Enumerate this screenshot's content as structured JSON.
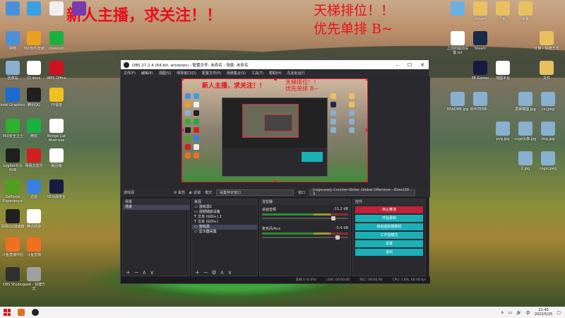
{
  "overlay": {
    "left": "新人主播，求关注！！",
    "right_line1": "天梯排位！！",
    "right_line2": "优先单排 B~"
  },
  "desktop_icons": [
    {
      "label": "",
      "icon": "computer-icon",
      "color": "#4a90d9"
    },
    {
      "label": "",
      "icon": "app-icon",
      "color": "#3aa0e0"
    },
    {
      "label": "",
      "icon": "document-icon",
      "color": "#eeeeee"
    },
    {
      "label": "",
      "icon": "app-icon",
      "color": "#7a3ab0"
    },
    {
      "label": "网络",
      "icon": "network-icon",
      "color": "#4a90d9"
    },
    {
      "label": "360软件管家",
      "icon": "app-icon",
      "color": "#e8a020"
    },
    {
      "label": "dyweixin",
      "icon": "app-icon",
      "color": "#1ab040"
    },
    {
      "label": "回收站",
      "icon": "recycle-bin-icon",
      "color": "#8ab0d0"
    },
    {
      "label": "打.docx",
      "icon": "document-icon",
      "color": "#ffffff"
    },
    {
      "label": "WPS Office",
      "icon": "wps-icon",
      "color": "#d01020"
    },
    {
      "label": "Intel Graphics",
      "icon": "app-icon",
      "color": "#1a6ad0"
    },
    {
      "label": "腾讯QQ",
      "icon": "qq-icon",
      "color": "#202020"
    },
    {
      "label": "YY语音",
      "icon": "app-icon",
      "color": "#f0c020"
    },
    {
      "label": "360安全卫士",
      "icon": "shield-icon",
      "color": "#30b030"
    },
    {
      "label": "微信",
      "icon": "wechat-icon",
      "color": "#1ab040"
    },
    {
      "label": "Bongo Cat Mver.exe",
      "icon": "app-icon",
      "color": "#ffffff"
    },
    {
      "label": "Logitech G HUB",
      "icon": "app-icon",
      "color": "#202020"
    },
    {
      "label": "网易云音乐",
      "icon": "music-icon",
      "color": "#d02020"
    },
    {
      "label": "解压缩",
      "icon": "document-icon",
      "color": "#ffffff"
    },
    {
      "label": "GeForce Experience",
      "icon": "nvidia-icon",
      "color": "#50a020"
    },
    {
      "label": "迅雷",
      "icon": "app-icon",
      "color": "#3a80e0"
    },
    {
      "label": "5E对战平台",
      "icon": "app-icon",
      "color": "#1a1a40"
    },
    {
      "label": "网易UU加速器",
      "icon": "app-icon",
      "color": "#202020"
    },
    {
      "label": "腾讯网游",
      "icon": "document-icon",
      "color": "#ffffff"
    },
    {
      "label": "斗鱼直播伴侣",
      "icon": "app-icon",
      "color": "#f07020"
    },
    {
      "label": "斗鱼直播",
      "icon": "app-icon",
      "color": "#f07020"
    },
    {
      "label": "OBS Studio",
      "icon": "obs-icon",
      "color": "#303030"
    },
    {
      "label": "geek - 快捷方式",
      "icon": "app-icon",
      "color": "#a0a0a0"
    }
  ],
  "right_icons": [
    {
      "label": "",
      "icon": "app-icon",
      "color": "#6ab0e0"
    },
    {
      "label": "Steam",
      "icon": "folder-icon",
      "color": "#e8c060"
    },
    {
      "label": "一起",
      "icon": "folder-icon",
      "color": "#e8c060"
    },
    {
      "label": "设置",
      "icon": "folder-icon",
      "color": "#e8c060"
    },
    {
      "label": "之前的驱动设置.txt",
      "icon": "document-icon",
      "color": "#ffffff"
    },
    {
      "label": "Steam",
      "icon": "steam-icon",
      "color": "#1a2a4a"
    },
    {
      "label": "计算 - 快捷方式",
      "icon": "folder-icon",
      "color": "#e8c060"
    },
    {
      "label": "5E Gamer",
      "icon": "app-icon",
      "color": "#1a1a40"
    },
    {
      "label": "地图平台",
      "icon": "app-icon",
      "color": "#ffffff"
    },
    {
      "label": "文件",
      "icon": "folder-icon",
      "color": "#e8c060"
    },
    {
      "label": "README.jpg",
      "icon": "image-icon",
      "color": "#8ab0d0"
    },
    {
      "label": "WHITEME...",
      "icon": "image-icon",
      "color": "#8ab0d0"
    },
    {
      "label": "屏幕截图.jpg",
      "icon": "image-icon",
      "color": "#8ab0d0"
    },
    {
      "label": "cs.jpeg",
      "icon": "image-icon",
      "color": "#8ab0d0"
    },
    {
      "label": "pvg.jpg",
      "icon": "image-icon",
      "color": "#8ab0d0"
    },
    {
      "label": "csgo头像.jpg",
      "icon": "image-icon",
      "color": "#8ab0d0"
    },
    {
      "label": "dog.jpg",
      "icon": "image-icon",
      "color": "#8ab0d0"
    },
    {
      "label": "2.jpg",
      "icon": "image-icon",
      "color": "#8ab0d0"
    },
    {
      "label": "csgo.jpeg",
      "icon": "image-icon",
      "color": "#8ab0d0"
    }
  ],
  "obs": {
    "title": "OBS 27.2.4 (64-bit, windows) - 配置文件: 未命名 - 场景: 未命名",
    "menu": [
      "文件(F)",
      "编辑(E)",
      "视图(V)",
      "停靠窗口(D)",
      "配置文件(P)",
      "场景集合(S)",
      "工具(T)",
      "帮助(H)",
      "在此处运行"
    ],
    "toolbar": {
      "source_label": "游戏源",
      "properties": "属性",
      "filters": "滤镜",
      "mode_label": "模式",
      "mode_value": "采集特定窗口",
      "window_label": "窗口",
      "window_value": "[csgo.exe]: Counter-Strike: Global Offensive - Direct3D 9"
    },
    "scenes": {
      "header": "场景",
      "items": [
        "场景"
      ]
    },
    "sources": {
      "header": "来源",
      "items": [
        "游戏源2",
        "视频捕获设备",
        "文本 (GDI+) 2",
        "文本 (GDI+)",
        "游戏源",
        "显示器采集"
      ]
    },
    "mixer": {
      "header": "混音器",
      "tracks": [
        {
          "name": "桌面音频",
          "db": "-11.2 dB"
        },
        {
          "name": "麦克风/Aux",
          "db": "-5.4 dB"
        }
      ]
    },
    "controls": {
      "header": "控件",
      "buttons": [
        "停止推流",
        "开始录制",
        "启动虚拟摄像机",
        "工作室模式",
        "设置",
        "退出"
      ]
    },
    "status": {
      "live": "LIVE: 00:00:00",
      "rec": "REC: 00:00:00",
      "cpu": "CPU: 1.8%, 60.00 fps",
      "dropped": "丢帧 0 (0.0%)"
    }
  },
  "taskbar": {
    "time": "21:40",
    "date": "2022/5/25",
    "lang": "中"
  }
}
